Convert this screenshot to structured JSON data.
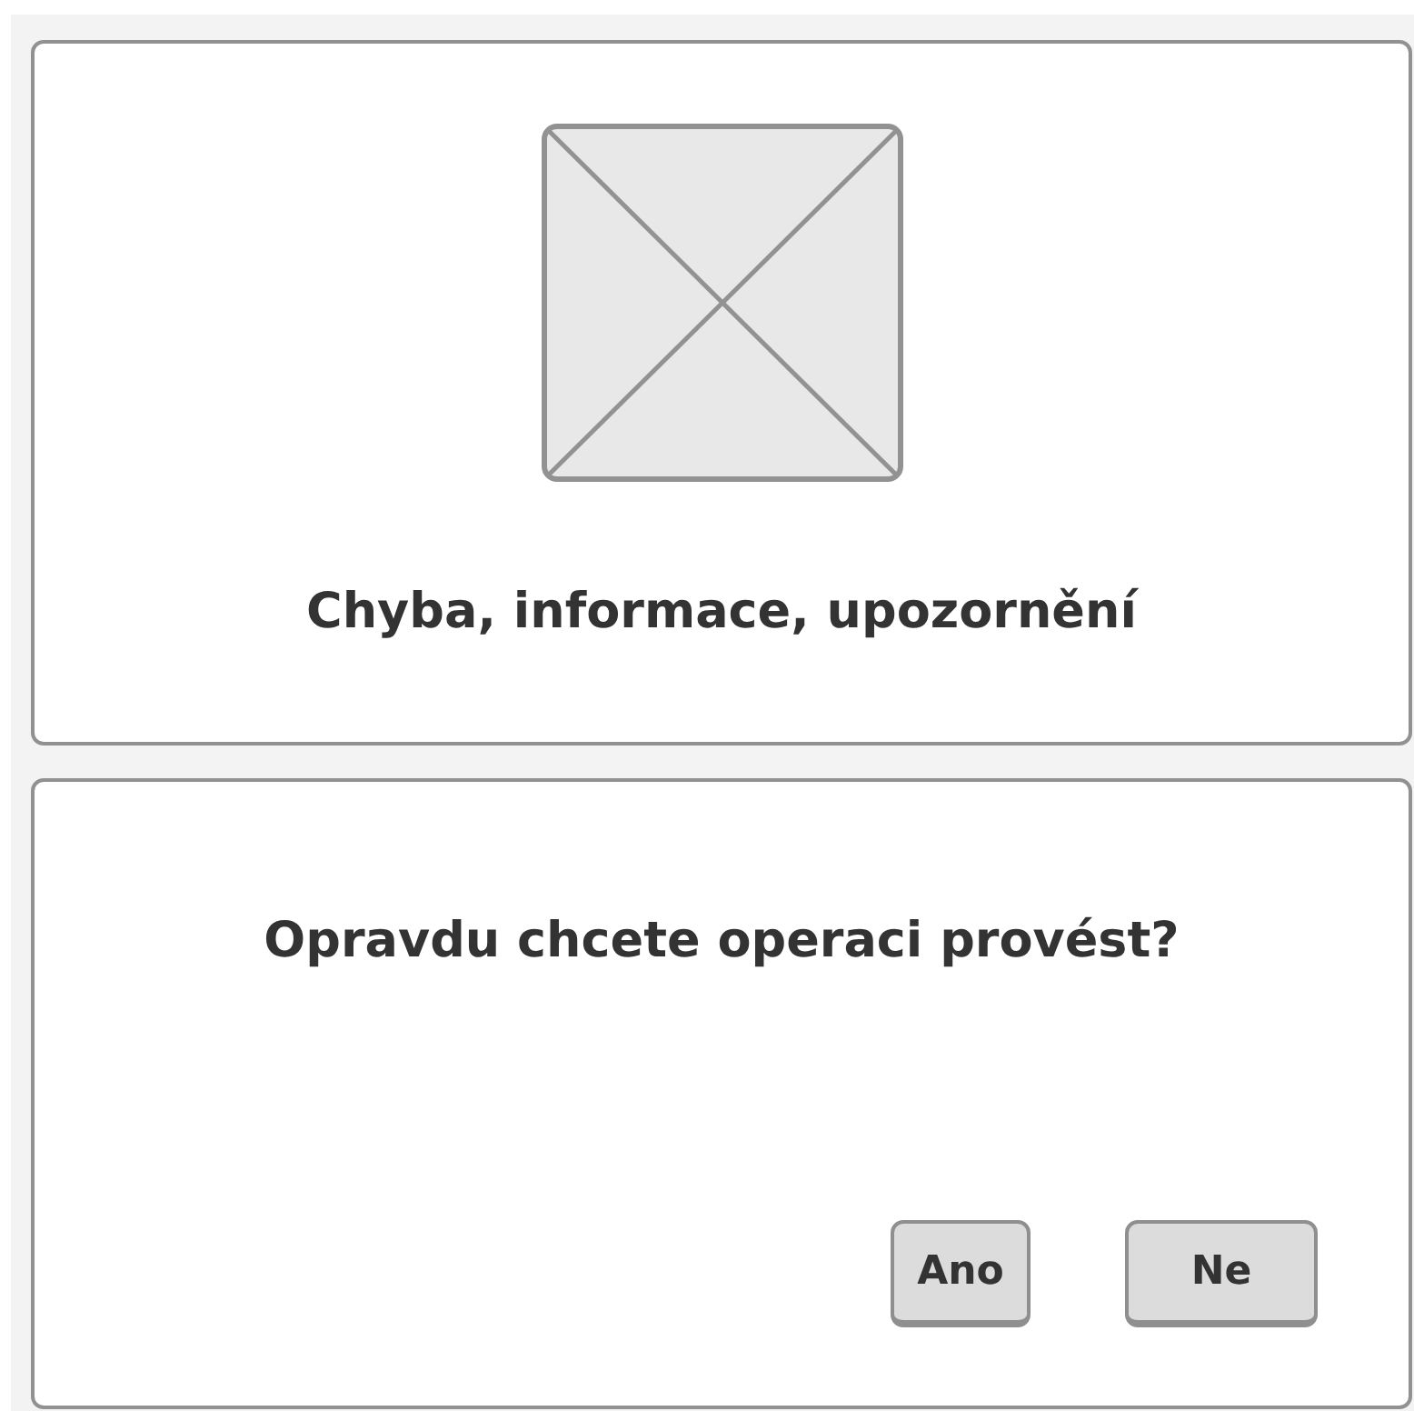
{
  "message_panel": {
    "title": "Chyba, informace, upozornění"
  },
  "confirm_dialog": {
    "question": "Opravdu chcete operaci provést?",
    "buttons": [
      {
        "label": "Ano"
      },
      {
        "label": "Ne"
      }
    ]
  }
}
